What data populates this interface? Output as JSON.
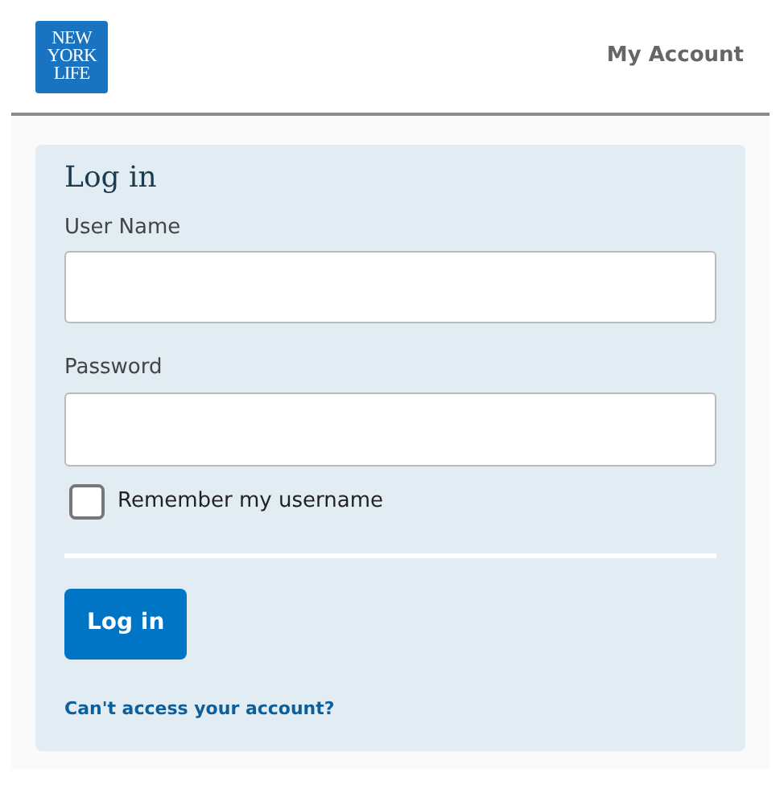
{
  "header": {
    "logo_lines": [
      "NEW",
      "YORK",
      "LIFE"
    ],
    "nav_link": "My Account"
  },
  "form": {
    "title": "Log in",
    "fields": [
      {
        "label": "User Name",
        "kind": "text"
      },
      {
        "label": "Password",
        "kind": "password"
      }
    ],
    "remember": {
      "label": "Remember my username",
      "checked": false
    },
    "submit": "Log in",
    "help_link": "Can't access your account?"
  }
}
